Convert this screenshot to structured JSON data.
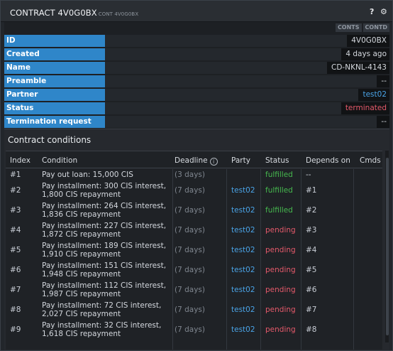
{
  "window": {
    "title": "CONTRACT 4V0G0BX",
    "subtitle": "CONT 4V0G0BX",
    "help_icon": "question-icon",
    "settings_icon": "gear-icon"
  },
  "toolbar": {
    "buttons": [
      "CONTS",
      "CONTD"
    ]
  },
  "details": [
    {
      "label": "ID",
      "value": "4V0G0BX"
    },
    {
      "label": "Created",
      "value": "4 days ago"
    },
    {
      "label": "Name",
      "value": "CD-NKNL-4143"
    },
    {
      "label": "Preamble",
      "value": "--"
    },
    {
      "label": "Partner",
      "value": "test02"
    },
    {
      "label": "Status",
      "value": "terminated"
    },
    {
      "label": "Termination request",
      "value": "--"
    }
  ],
  "colors": {
    "label_bg": "#2f86c9",
    "link": "#4aa3e6",
    "fulfilled": "#46b84e",
    "pending": "#e4596a",
    "terminated": "#e4596a"
  },
  "conditions": {
    "title": "Contract conditions",
    "columns": [
      "Index",
      "Condition",
      "Deadline",
      "Party",
      "Status",
      "Depends on",
      "Cmds"
    ],
    "deadline_info_icon": "info-icon",
    "rows": [
      {
        "index": "#1",
        "condition_1": "Pay out loan: 15,000 CIS",
        "condition_2": "",
        "deadline": "(3 days)",
        "party": "",
        "status": "fulfilled",
        "depends": "--"
      },
      {
        "index": "#2",
        "condition_1": "Pay installment: 300 CIS interest,",
        "condition_2": "1,800 CIS repayment",
        "deadline": "(7 days)",
        "party": "test02",
        "status": "fulfilled",
        "depends": "#1"
      },
      {
        "index": "#3",
        "condition_1": "Pay installment: 264 CIS interest,",
        "condition_2": "1,836 CIS repayment",
        "deadline": "(7 days)",
        "party": "test02",
        "status": "fulfilled",
        "depends": "#2"
      },
      {
        "index": "#4",
        "condition_1": "Pay installment: 227 CIS interest,",
        "condition_2": "1,872 CIS repayment",
        "deadline": "(7 days)",
        "party": "test02",
        "status": "pending",
        "depends": "#3"
      },
      {
        "index": "#5",
        "condition_1": "Pay installment: 189 CIS interest,",
        "condition_2": "1,910 CIS repayment",
        "deadline": "(7 days)",
        "party": "test02",
        "status": "pending",
        "depends": "#4"
      },
      {
        "index": "#6",
        "condition_1": "Pay installment: 151 CIS interest,",
        "condition_2": "1,948 CIS repayment",
        "deadline": "(7 days)",
        "party": "test02",
        "status": "pending",
        "depends": "#5"
      },
      {
        "index": "#7",
        "condition_1": "Pay installment: 112 CIS interest,",
        "condition_2": "1,987 CIS repayment",
        "deadline": "(7 days)",
        "party": "test02",
        "status": "pending",
        "depends": "#6"
      },
      {
        "index": "#8",
        "condition_1": "Pay installment: 72 CIS interest,",
        "condition_2": "2,027 CIS repayment",
        "deadline": "(7 days)",
        "party": "test02",
        "status": "pending",
        "depends": "#7"
      },
      {
        "index": "#9",
        "condition_1": "Pay installment: 32 CIS interest,",
        "condition_2": "1,618 CIS repayment",
        "deadline": "(7 days)",
        "party": "test02",
        "status": "pending",
        "depends": "#8"
      }
    ]
  }
}
